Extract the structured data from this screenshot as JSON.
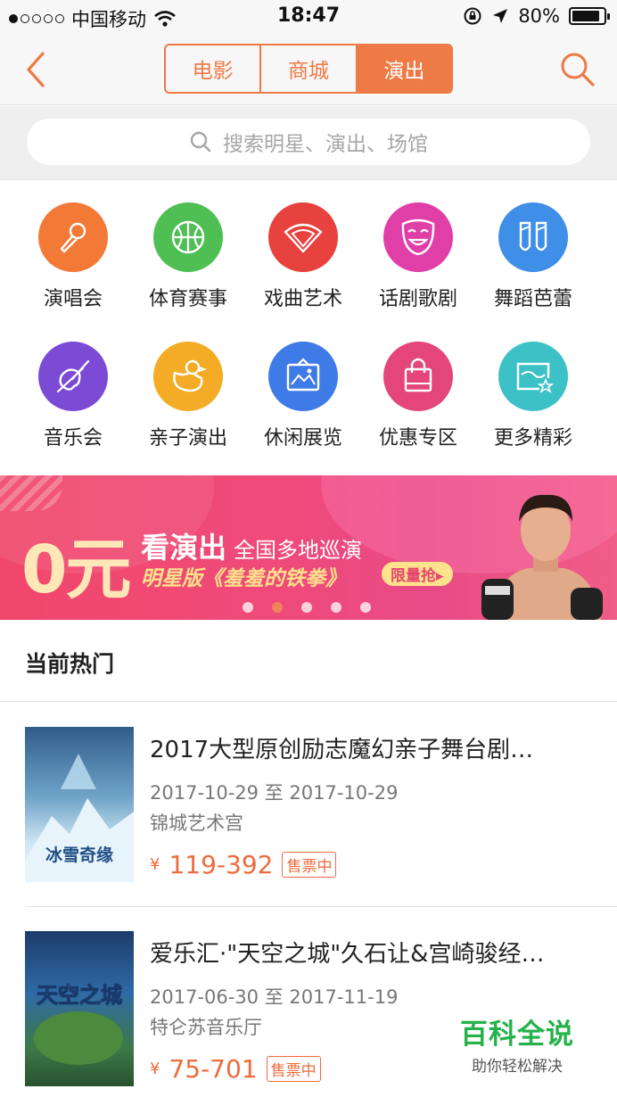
{
  "status_bar": {
    "carrier": "中国移动",
    "time": "18:47",
    "battery": "80%"
  },
  "nav": {
    "tabs": [
      {
        "label": "电影"
      },
      {
        "label": "商城"
      },
      {
        "label": "演出"
      }
    ],
    "active_tab": "演出"
  },
  "search": {
    "placeholder": "搜索明星、演出、场馆"
  },
  "categories": [
    {
      "label": "演唱会",
      "icon": "microphone-icon",
      "color": "#f27a36"
    },
    {
      "label": "体育赛事",
      "icon": "basketball-icon",
      "color": "#4fbf53"
    },
    {
      "label": "戏曲艺术",
      "icon": "fan-icon",
      "color": "#e8423f"
    },
    {
      "label": "话剧歌剧",
      "icon": "mask-icon",
      "color": "#df3fa6"
    },
    {
      "label": "舞蹈芭蕾",
      "icon": "ballet-shoes-icon",
      "color": "#3f8fe8"
    },
    {
      "label": "音乐会",
      "icon": "violin-icon",
      "color": "#7b4bd6"
    },
    {
      "label": "亲子演出",
      "icon": "duck-icon",
      "color": "#f4ac27"
    },
    {
      "label": "休闲展览",
      "icon": "picture-frame-icon",
      "color": "#3f7be6"
    },
    {
      "label": "优惠专区",
      "icon": "shopping-bag-icon",
      "color": "#e4457a"
    },
    {
      "label": "更多精彩",
      "icon": "picture-star-icon",
      "color": "#3cc2c6"
    }
  ],
  "banner": {
    "big": "0元",
    "headline": "看演出",
    "sub": "全国多地巡演",
    "line2": "明星版《羞羞的铁拳》",
    "cta": "限量抢▸",
    "slide_count": 5,
    "active_slide": 2
  },
  "hot": {
    "title": "当前热门",
    "items": [
      {
        "title": "2017大型原创励志魔幻亲子舞台剧…",
        "date": "2017-10-29 至 2017-10-29",
        "venue": "锦城艺术宫",
        "currency": "¥",
        "price": "119-392",
        "badge": "售票中",
        "poster_text": "冰雪奇缘"
      },
      {
        "title": "爱乐汇·\"天空之城\"久石让&宫崎骏经…",
        "date": "2017-06-30 至 2017-11-19",
        "venue": "特仑苏音乐厅",
        "currency": "¥",
        "price": "75-701",
        "badge": "售票中",
        "poster_text": "天空之城"
      }
    ]
  },
  "watermark": {
    "title": "百科全说",
    "subtitle": "助你轻松解决"
  }
}
